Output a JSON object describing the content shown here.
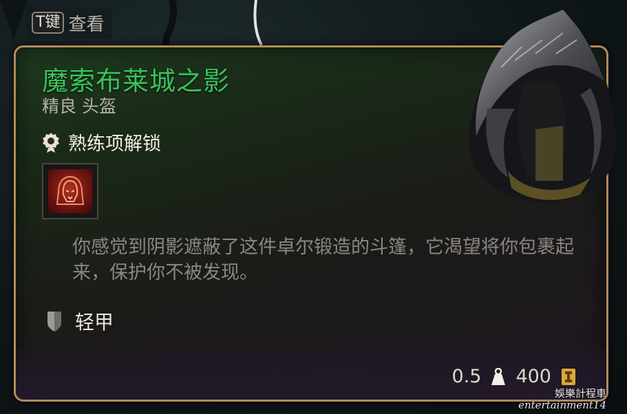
{
  "hint": {
    "key": "T键",
    "label": "查看"
  },
  "item": {
    "name": "魔索布莱城之影",
    "rarity_type": "精良 头盔",
    "rarity_color": "#39c35a",
    "mastery_label": "熟练项解锁",
    "spell_icon": "hooded-face-icon",
    "description": "你感觉到阴影遮蔽了这件卓尔锻造的斗篷，它渴望将你包裹起来，保护你不被发现。",
    "armor_type": "轻甲",
    "weight": "0.5",
    "value": "400"
  },
  "watermark": {
    "line1": "娛樂計程車",
    "line2": "entertainment14"
  }
}
